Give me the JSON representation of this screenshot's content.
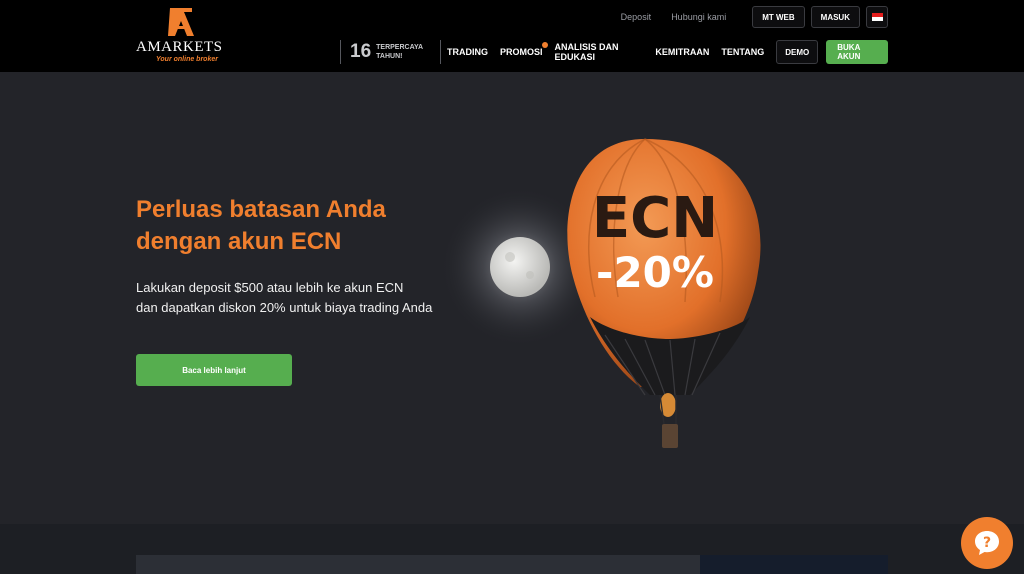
{
  "brand": {
    "name": "AMARKETS",
    "tagline": "Your online broker",
    "accent": "#f07f2e",
    "green": "#56ae4f"
  },
  "topbar": {
    "links": [
      "Deposit",
      "Hubungi kami"
    ],
    "mt_web": "MT WEB",
    "login": "MASUK",
    "language_flag": "indonesia-flag-icon"
  },
  "nav": {
    "years_num": "16",
    "years_label": "TERPERCAYA TAHUN!",
    "items": [
      "TRADING",
      "PROMOSI",
      "ANALISIS DAN EDUKASI",
      "KEMITRAAN",
      "TENTANG"
    ],
    "demo": "DEMO",
    "open_account": "BUKA AKUN"
  },
  "hero": {
    "title_line1": "Perluas batasan Anda",
    "title_line2": "dengan akun ECN",
    "desc_line1": "Lakukan deposit $500 atau lebih ke akun ECN",
    "desc_line2": "dan dapatkan diskon 20% untuk biaya trading Anda",
    "cta": "Baca lebih lanjut",
    "balloon_text": "ECN",
    "balloon_discount": "-20%"
  },
  "help": {
    "icon": "question-chat-icon"
  }
}
